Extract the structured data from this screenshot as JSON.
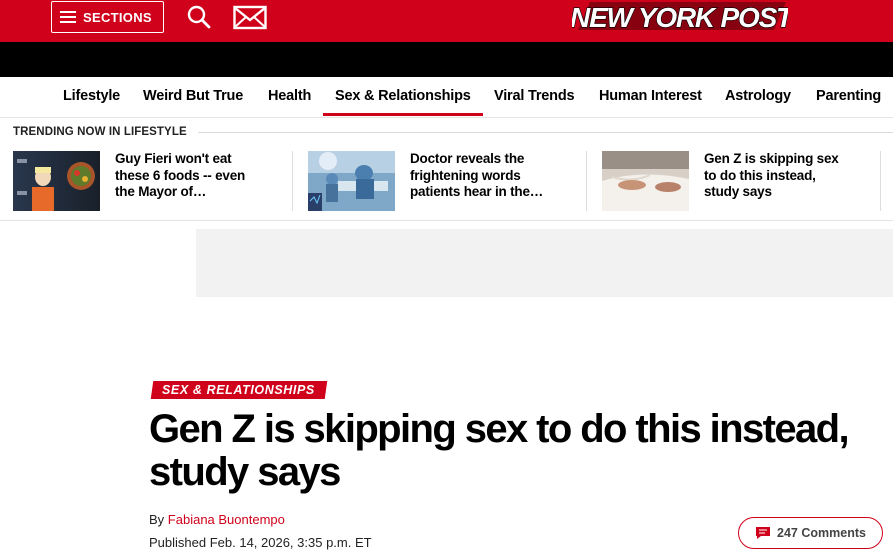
{
  "header": {
    "sections_label": "SECTIONS",
    "logo_text": "NEW YORK POST",
    "icons": [
      "hamburger-icon",
      "search-icon",
      "mail-icon"
    ],
    "brand_color": "#d0021b"
  },
  "nav": {
    "items": [
      "Lifestyle",
      "Weird But True",
      "Health",
      "Sex & Relationships",
      "Viral Trends",
      "Human Interest",
      "Astrology",
      "Parenting"
    ],
    "active": "Sex & Relationships"
  },
  "trending": {
    "label": "TRENDING NOW IN LIFESTYLE",
    "cards": [
      {
        "title": "Guy Fieri won't eat these 6 foods -- even the Mayor of…"
      },
      {
        "title": "Doctor reveals the frightening words patients hear in the…"
      },
      {
        "title": "Gen Z is skipping sex to do this instead, study says"
      }
    ]
  },
  "article": {
    "kicker": "SEX & RELATIONSHIPS",
    "headline": "Gen Z is skipping sex to do this instead, study says",
    "by_prefix": "By",
    "author": "Fabiana Buontempo",
    "published": "Published Feb. 14, 2026, 3:35 p.m. ET",
    "comments": "247 Comments"
  }
}
